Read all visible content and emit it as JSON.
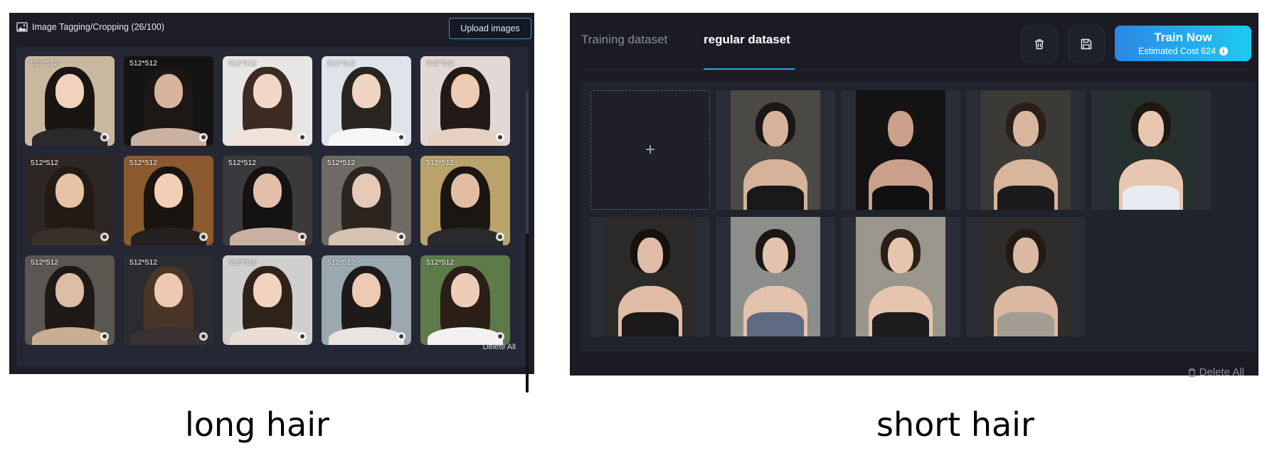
{
  "left_panel": {
    "title": "Image Tagging/Cropping (26/100)",
    "title_icon": "image-icon",
    "upload_label": "Upload images",
    "delete_all_label": "Delete All",
    "thumbnails": [
      {
        "size": "512*512",
        "bg": "#c9b8a0",
        "hair": "#1a1413",
        "skin": "#f0d2bd",
        "top": "#2a2a2a"
      },
      {
        "size": "512*512",
        "bg": "#141414",
        "hair": "#1c1714",
        "skin": "#d8b49c",
        "top": "#cbb1a0"
      },
      {
        "size": "512*512",
        "bg": "#e8e6e4",
        "hair": "#3c2b22",
        "skin": "#f3d7c6",
        "top": "#f0e2d8"
      },
      {
        "size": "512*512",
        "bg": "#dfe4ea",
        "hair": "#2a2420",
        "skin": "#f1d5c3",
        "top": "#f6f6f6"
      },
      {
        "size": "512*512",
        "bg": "#e4d8d4",
        "hair": "#221a16",
        "skin": "#eccab4",
        "top": "#e6d0c2"
      },
      {
        "size": "512*512",
        "bg": "#2c2624",
        "hair": "#241a14",
        "skin": "#e7c2a5",
        "top": "#3a302a"
      },
      {
        "size": "512*512",
        "bg": "#8b5a2e",
        "hair": "#1a1410",
        "skin": "#f2cfb4",
        "top": "#242020"
      },
      {
        "size": "512*512",
        "bg": "#3a3a3c",
        "hair": "#141212",
        "skin": "#e2c0ac",
        "top": "#c8b0a2"
      },
      {
        "size": "512*512",
        "bg": "#6e6a66",
        "hair": "#2c241e",
        "skin": "#e6c9b6",
        "top": "#d8c2b2"
      },
      {
        "size": "512*512",
        "bg": "#b9a36a",
        "hair": "#1c1612",
        "skin": "#e2bda3",
        "top": "#2a2a2c"
      },
      {
        "size": "512*512",
        "bg": "#5a5650",
        "hair": "#1e1916",
        "skin": "#dcbca4",
        "top": "#c9ae94"
      },
      {
        "size": "512*512",
        "bg": "#2a2c30",
        "hair": "#4a3526",
        "skin": "#ecc9b0",
        "top": "#3a3230"
      },
      {
        "size": "512*512",
        "bg": "#cfcfcd",
        "hair": "#2e221a",
        "skin": "#f2d3be",
        "top": "#e9ddd4"
      },
      {
        "size": "512*512",
        "bg": "#9aa8b0",
        "hair": "#1e1a18",
        "skin": "#eccab4",
        "top": "#e8e4e2"
      },
      {
        "size": "512*512",
        "bg": "#5e7a4a",
        "hair": "#2a1e16",
        "skin": "#eccdb8",
        "top": "#f4f2f0"
      }
    ],
    "scroll_fraction": 0.53
  },
  "right_panel": {
    "tabs": [
      {
        "label": "Training dataset",
        "active": false
      },
      {
        "label": "regular dataset",
        "active": true
      }
    ],
    "trash_icon": "trash-icon",
    "save_icon": "save-icon",
    "train_label": "Train Now",
    "train_cost": "Estimated Cost 624",
    "info_icon": "info-icon",
    "add_symbol": "+",
    "delete_all_label": "Delete All",
    "tiles": [
      {
        "bg": "#4b4945",
        "hair": "#1a1614",
        "skin": "#d7b29b",
        "garment": "#18181a"
      },
      {
        "bg": "#121214",
        "hair": "#161312",
        "skin": "#c9a089",
        "garment": "#101012"
      },
      {
        "bg": "#3c3a36",
        "hair": "#2a201a",
        "skin": "#d8b59d",
        "garment": "#1c1a1a"
      },
      {
        "bg": "#26302c",
        "hair": "#1e1712",
        "skin": "#e7c7b1",
        "garment": "#e8ecf2"
      },
      {
        "bg": "#2c2a28",
        "hair": "#14110f",
        "skin": "#e0bca6",
        "garment": "#1a1818"
      },
      {
        "bg": "#8c8e8c",
        "hair": "#1c1714",
        "skin": "#e4c3ae",
        "garment": "#5e6a80"
      },
      {
        "bg": "#9b968c",
        "hair": "#2a1f18",
        "skin": "#e6c5ae",
        "garment": "#1e1c1c"
      },
      {
        "bg": "#2e2d2c",
        "hair": "#221a15",
        "skin": "#dbb9a2",
        "garment": "#a39c92"
      }
    ]
  },
  "captions": {
    "left": "long hair",
    "right": "short hair"
  },
  "colors": {
    "panel_bg": "#1c1d26",
    "accent": "#2aa8d8",
    "train_gradient_start": "#2d86e6",
    "train_gradient_end": "#1ecbef"
  }
}
